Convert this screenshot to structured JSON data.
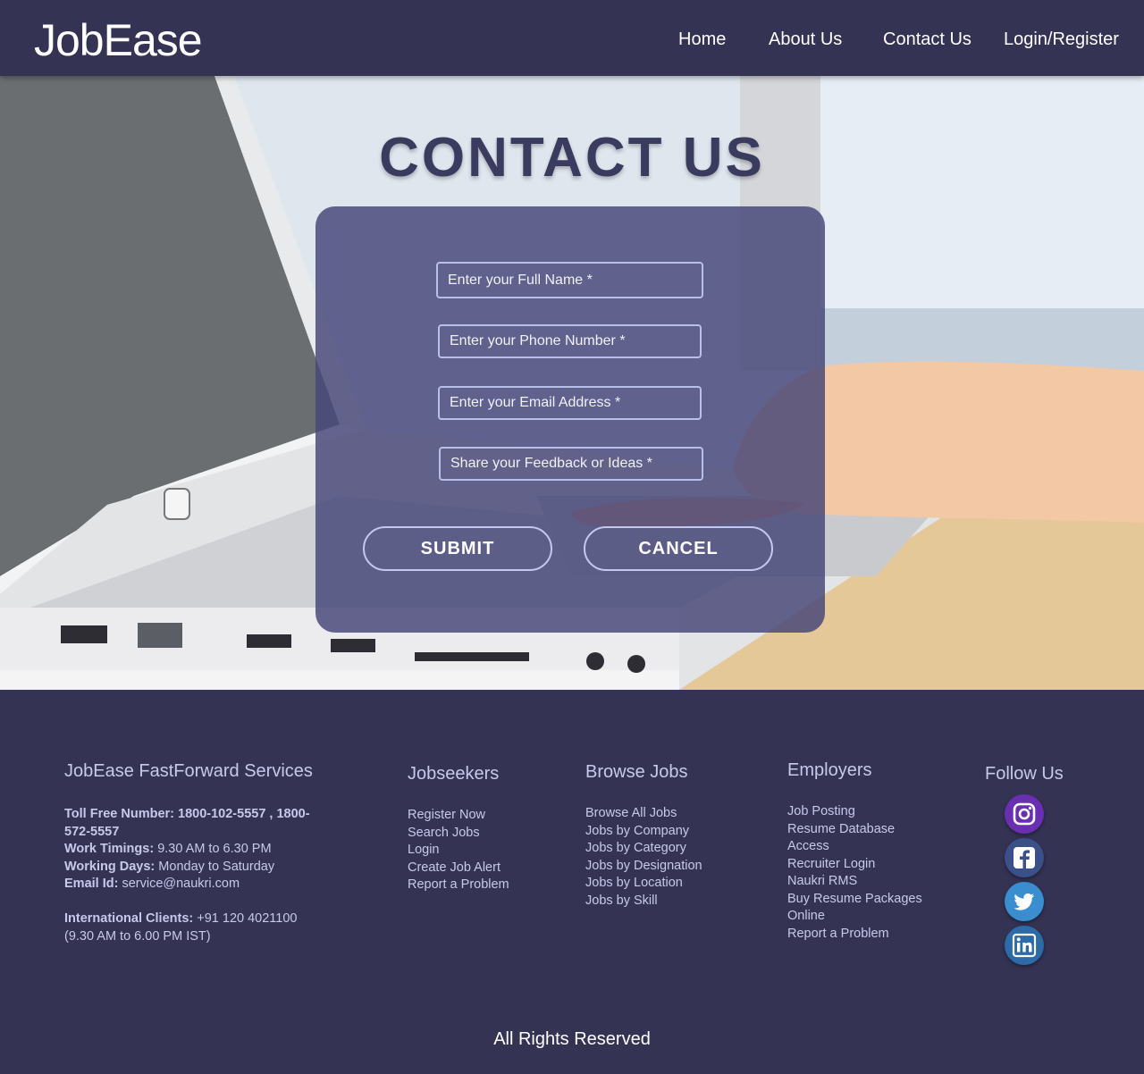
{
  "brand": {
    "logo": "JobEase"
  },
  "nav": [
    {
      "label": "Home"
    },
    {
      "label": "About Us"
    },
    {
      "label": "Contact Us"
    },
    {
      "label": "Login/Register"
    }
  ],
  "hero": {
    "title": "CONTACT US",
    "form": {
      "name_placeholder": "Enter your Full Name *",
      "phone_placeholder": "Enter your Phone Number *",
      "email_placeholder": "Enter your Email Address *",
      "feedback_placeholder": "Share your Feedback or Ideas *",
      "submit_label": "SUBMIT",
      "cancel_label": "CANCEL"
    }
  },
  "footer": {
    "services": {
      "title": "JobEase FastForward Services",
      "toll_free_label": "Toll Free Number: 1800-102-5557 , 1800-572-5557",
      "timings_label": "Work Timings:",
      "timings_value": "9.30 AM to 6.30 PM",
      "days_label": "Working Days:",
      "days_value": "Monday to Saturday",
      "email_label": "Email Id:",
      "email_value": "service@naukri.com",
      "intl_label": "International Clients:",
      "intl_value": "+91 120 4021100",
      "intl_hours": "(9.30 AM to 6.00 PM IST)"
    },
    "jobseekers": {
      "title": "Jobseekers",
      "links": [
        "Register Now",
        "Search Jobs",
        "Login",
        "Create Job Alert",
        "Report a Problem"
      ]
    },
    "browse": {
      "title": "Browse Jobs",
      "links": [
        "Browse All Jobs",
        "Jobs by Company",
        "Jobs by Category",
        "Jobs by Designation",
        "Jobs by Location",
        "Jobs by Skill"
      ]
    },
    "employers": {
      "title": "Employers",
      "links": [
        "Job Posting",
        "Resume Database Access",
        "Recruiter Login",
        "Naukri RMS",
        "Buy Resume Packages Online",
        "Report a Problem"
      ]
    },
    "follow": {
      "title": "Follow Us",
      "icons": [
        "instagram-icon",
        "facebook-icon",
        "twitter-icon",
        "linkedin-icon"
      ]
    },
    "copyright": "All Rights Reserved"
  },
  "colors": {
    "navy": "#343354",
    "card": "#484878",
    "instagram": "#6a2fb0",
    "facebook": "#3b4f88",
    "twitter": "#3a8ed0",
    "linkedin": "#2c6aa8"
  }
}
